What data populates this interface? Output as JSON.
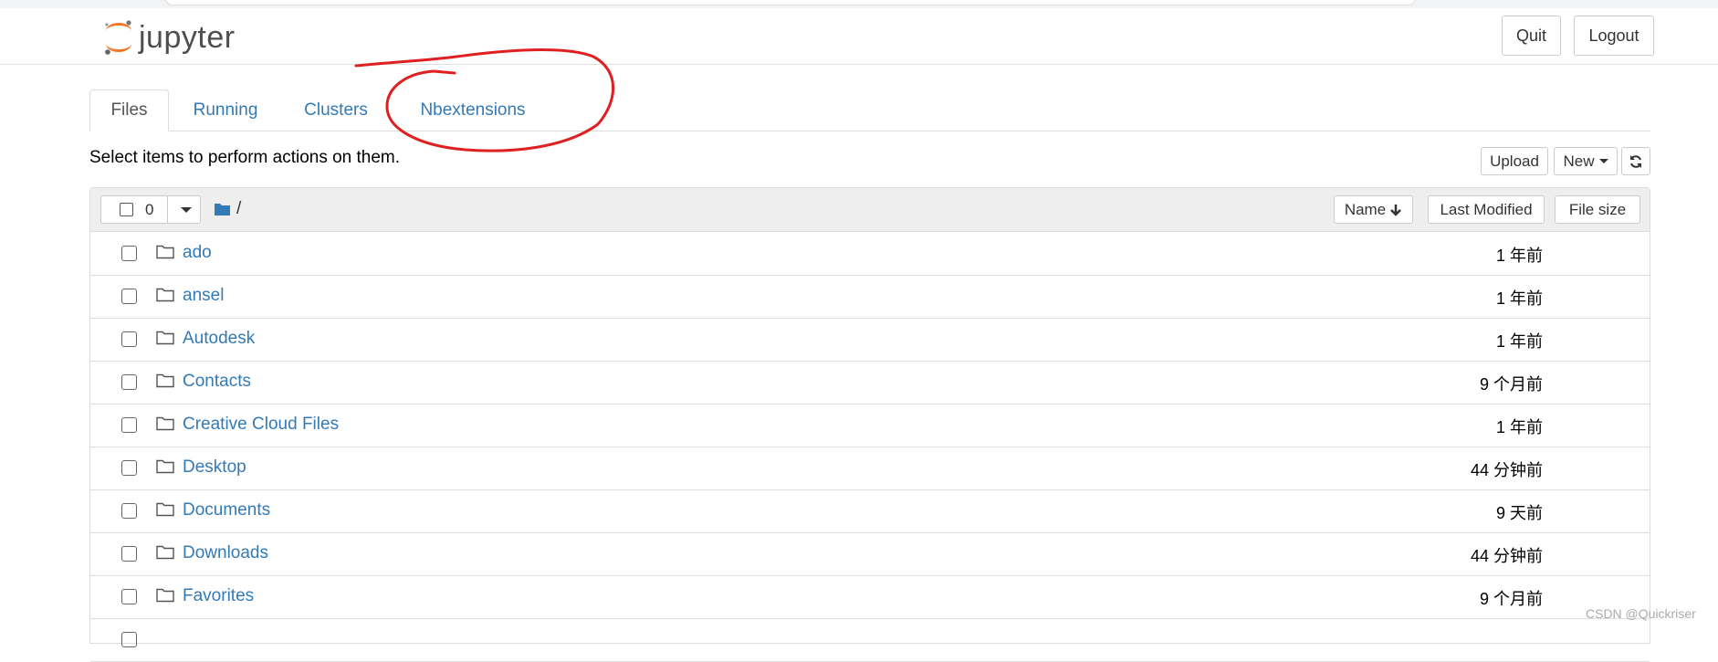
{
  "header": {
    "logo_text": "jupyter",
    "quit_label": "Quit",
    "logout_label": "Logout"
  },
  "tabs": [
    {
      "label": "Files",
      "active": true
    },
    {
      "label": "Running",
      "active": false
    },
    {
      "label": "Clusters",
      "active": false
    },
    {
      "label": "Nbextensions",
      "active": false
    }
  ],
  "toolbar": {
    "hint": "Select items to perform actions on them.",
    "upload_label": "Upload",
    "new_label": "New"
  },
  "list_header": {
    "selected_count": "0",
    "breadcrumb": "/",
    "name_label": "Name",
    "last_modified_label": "Last Modified",
    "file_size_label": "File size"
  },
  "files": [
    {
      "name": "ado",
      "modified": "1 年前"
    },
    {
      "name": "ansel",
      "modified": "1 年前"
    },
    {
      "name": "Autodesk",
      "modified": "1 年前"
    },
    {
      "name": "Contacts",
      "modified": "9 个月前"
    },
    {
      "name": "Creative Cloud Files",
      "modified": "1 年前"
    },
    {
      "name": "Desktop",
      "modified": "44 分钟前"
    },
    {
      "name": "Documents",
      "modified": "9 天前"
    },
    {
      "name": "Downloads",
      "modified": "44 分钟前"
    },
    {
      "name": "Favorites",
      "modified": "9 个月前"
    }
  ],
  "watermark": "CSDN @Quickriser",
  "colors": {
    "link": "#337ab7",
    "logo_orange": "#f37726",
    "annotation": "#e02020"
  }
}
